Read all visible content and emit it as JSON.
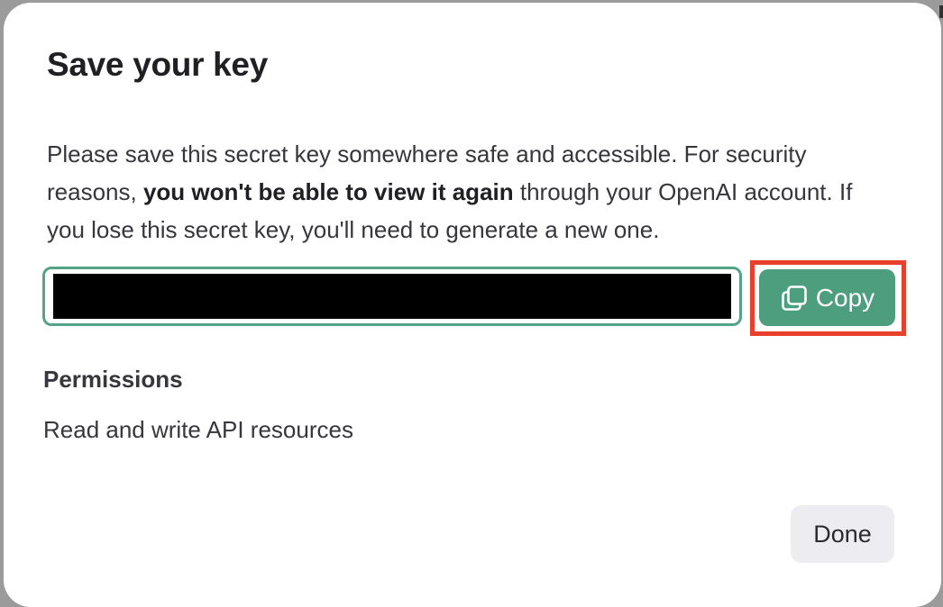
{
  "dialog": {
    "title": "Save your key",
    "description": {
      "part1": "Please save this secret key somewhere safe and accessible. For security reasons, ",
      "emphasis": "you won't be able to view it again",
      "part2": " through your OpenAI account. If you lose this secret key, you'll need to generate a new one."
    },
    "copy_button": {
      "label": "Copy",
      "icon": "copy-icon",
      "highlighted": true,
      "color": "#4d9e7e",
      "highlight_color": "#e8402a"
    },
    "permissions": {
      "heading": "Permissions",
      "value": "Read and write API resources"
    },
    "done_button": {
      "label": "Done"
    },
    "accent_color": "#54a386"
  }
}
